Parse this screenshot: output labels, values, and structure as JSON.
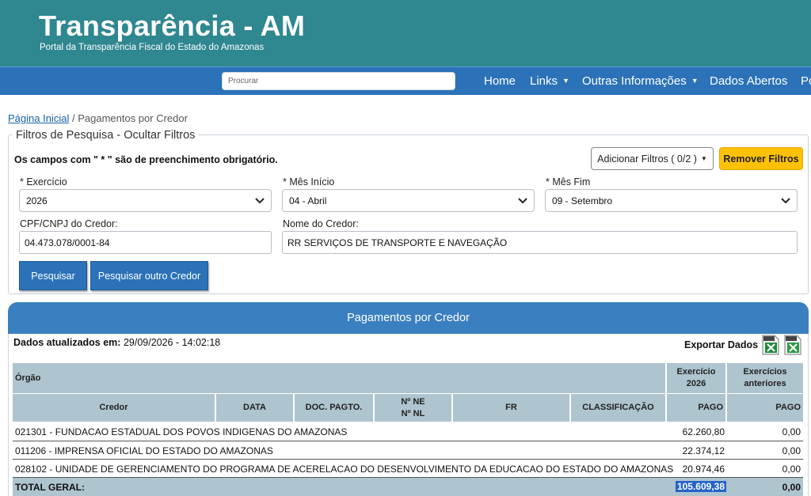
{
  "header": {
    "title": "Transparência - AM",
    "subtitle": "Portal da Transparência Fiscal do Estado do Amazonas"
  },
  "navbar": {
    "search_placeholder": "Procurar",
    "items": [
      {
        "label": "Home",
        "has_dropdown": false
      },
      {
        "label": "Links",
        "has_dropdown": true
      },
      {
        "label": "Outras Informações",
        "has_dropdown": true
      },
      {
        "label": "Dados Abertos",
        "has_dropdown": false
      },
      {
        "label": "Po",
        "has_dropdown": false
      }
    ]
  },
  "breadcrumb": {
    "home": "Página Inicial",
    "separator": "/",
    "current": "Pagamentos por Credor"
  },
  "filters": {
    "legend": "Filtros de Pesquisa - Ocultar Filtros",
    "required_note": "Os campos com \" * \" são de preenchimento obrigatório.",
    "add_filters_label": "Adicionar Filtros ( 0/2 )",
    "remove_filters_label": "Remover Filtros",
    "exercicio": {
      "label": "* Exercício",
      "value": "2026"
    },
    "mes_inicio": {
      "label": "* Mês Início",
      "value": "04 - Abril"
    },
    "mes_fim": {
      "label": "* Mês Fim",
      "value": "09 - Setembro"
    },
    "cpf_cnpj": {
      "label": "CPF/CNPJ do Credor:",
      "value": "04.473.078/0001-84"
    },
    "nome_credor": {
      "label": "Nome do Credor:",
      "value": "RR SERVIÇOS DE TRANSPORTE E NAVEGAÇÃO"
    },
    "search_button": "Pesquisar",
    "search_other_button": "Pesquisar outro Credor"
  },
  "results": {
    "title": "Pagamentos por Credor",
    "updated_label": "Dados atualizados em:",
    "updated_value": "29/09/2026 - 14:02:18",
    "export_label": "Exportar Dados",
    "export_icons": [
      "csv-file-icon",
      "xls-file-icon"
    ],
    "table": {
      "header_row1": {
        "orgao": "Órgão",
        "exercicio": "Exercício 2026",
        "anteriores": "Exercícios anteriores"
      },
      "header_row2": {
        "credor": "Credor",
        "data": "DATA",
        "doc_pagto": "DOC. PAGTO.",
        "ne_nl": "Nº NE Nº NL",
        "fr": "FR",
        "classificacao": "CLASSIFICAÇÃO",
        "pago_atual": "PAGO",
        "pago_anterior": "PAGO"
      },
      "rows": [
        {
          "orgao": "021301 - FUNDACAO ESTADUAL DOS POVOS INDIGENAS DO AMAZONAS",
          "pago_atual": "62.260,80",
          "pago_anterior": "0,00"
        },
        {
          "orgao": "011206 - IMPRENSA OFICIAL DO ESTADO DO AMAZONAS",
          "pago_atual": "22.374,12",
          "pago_anterior": "0,00"
        },
        {
          "orgao": "028102 - UNIDADE DE GERENCIAMENTO DO PROGRAMA DE ACERELACAO DO DESENVOLVIMENTO DA EDUCACAO DO ESTADO DO AMAZONAS",
          "pago_atual": "20.974,46",
          "pago_anterior": "0,00"
        }
      ],
      "total": {
        "label": "TOTAL GERAL:",
        "pago_atual": "105.609,38",
        "pago_anterior": "0,00"
      }
    }
  },
  "colors": {
    "header_bg": "#2f8790",
    "navbar_bg": "#2b72b8",
    "results_bar": "#3a7fbf",
    "table_header": "#aec4cf",
    "warning_button": "#ffc107"
  }
}
